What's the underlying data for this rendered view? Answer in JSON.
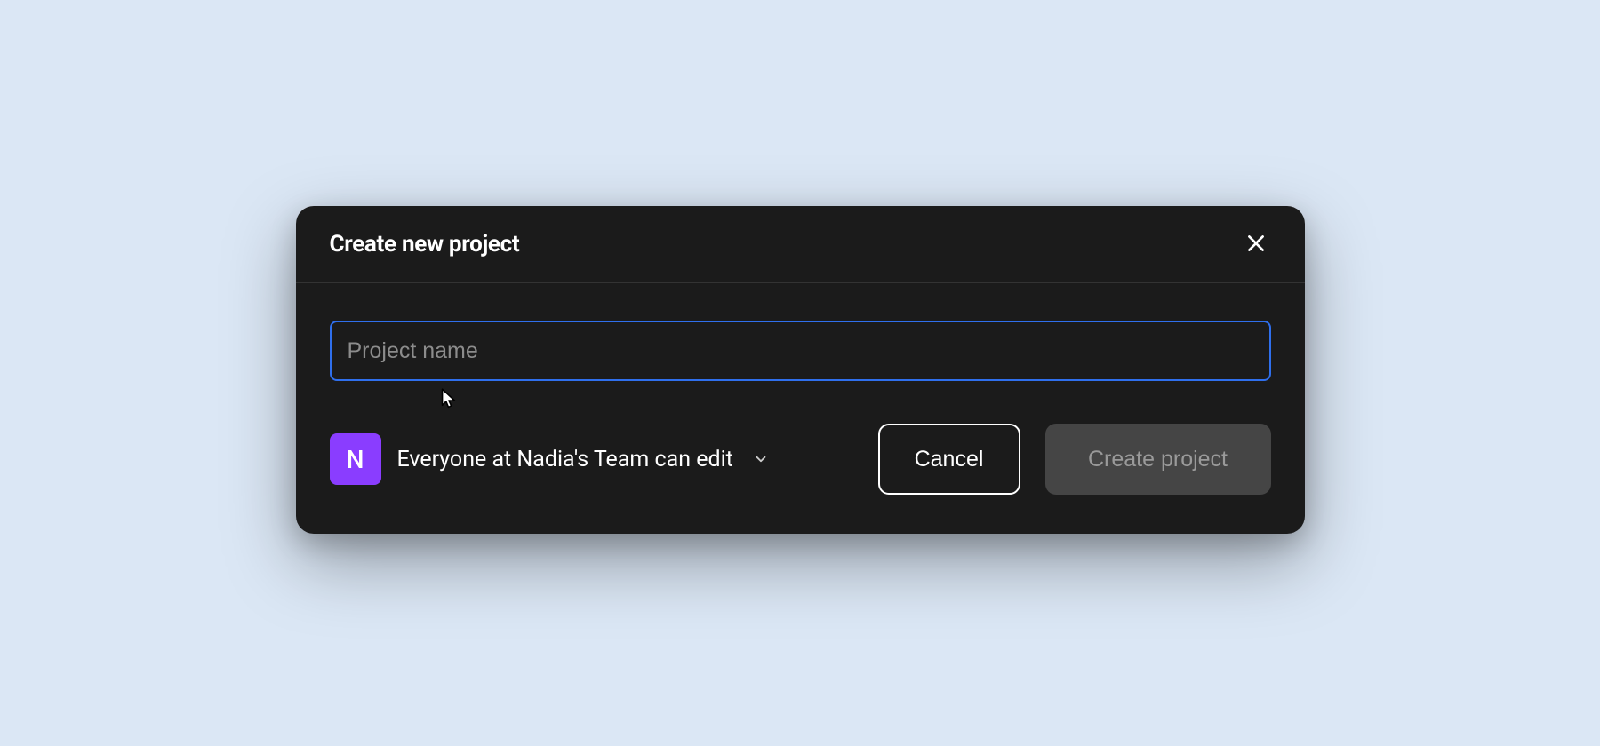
{
  "modal": {
    "title": "Create new project",
    "input": {
      "placeholder": "Project name",
      "value": ""
    },
    "permission": {
      "avatar_initial": "N",
      "label": "Everyone at Nadia's Team can edit"
    },
    "buttons": {
      "cancel": "Cancel",
      "create": "Create project"
    }
  },
  "colors": {
    "accent": "#2f6fed",
    "avatar": "#8a3dff"
  }
}
